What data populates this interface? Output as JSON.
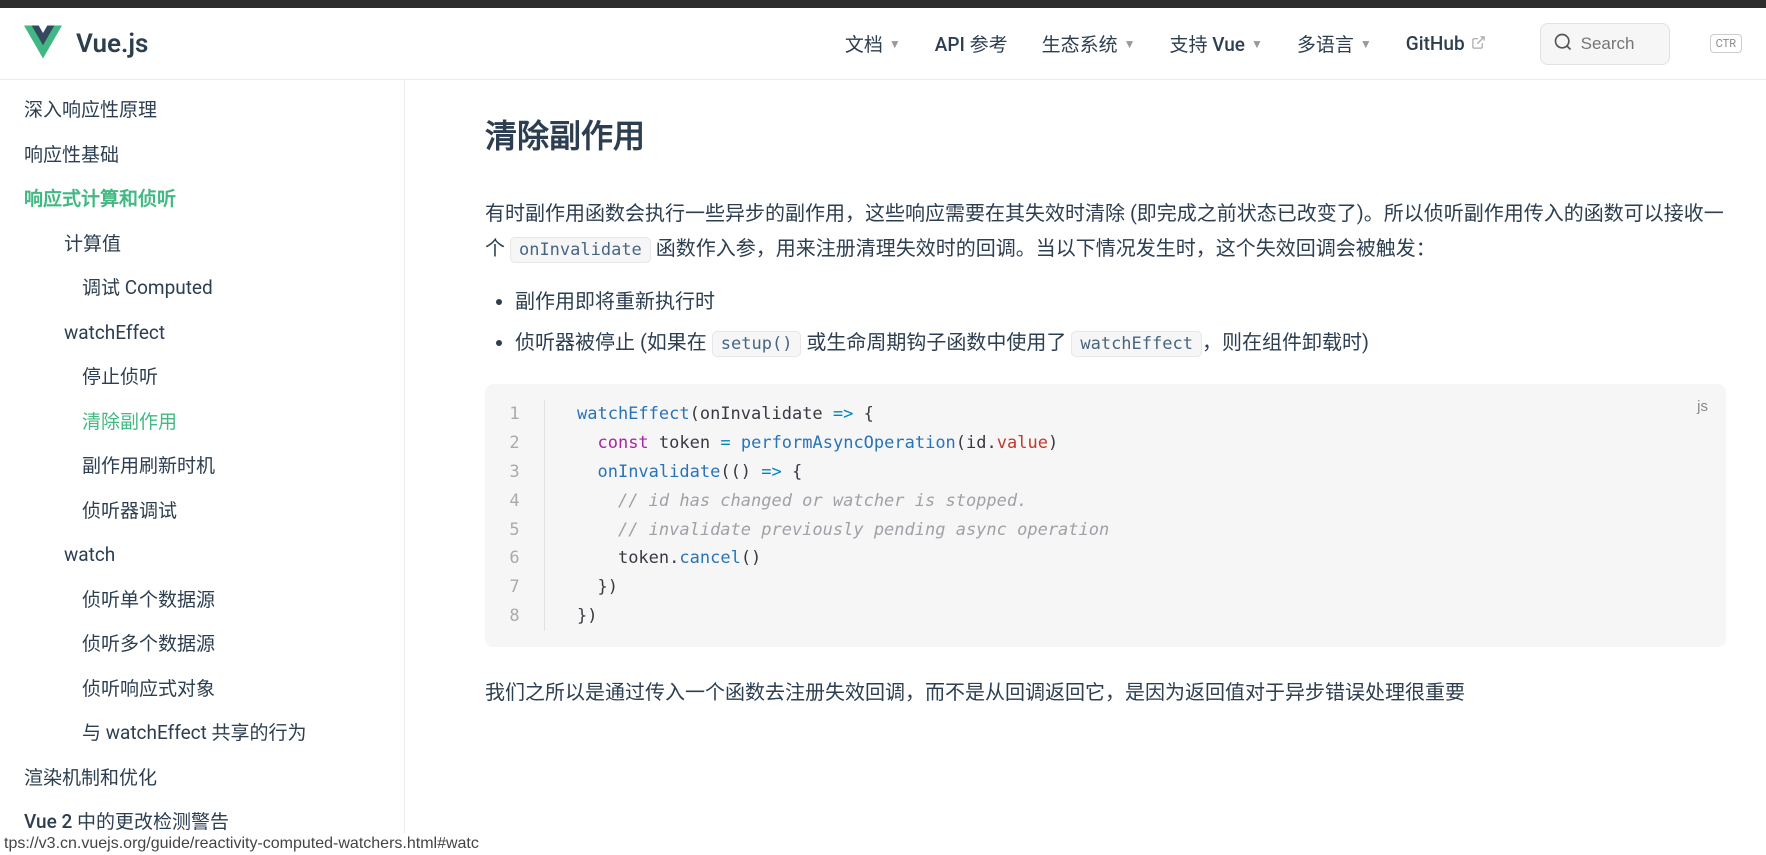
{
  "header": {
    "brand": "Vue.js",
    "nav": [
      {
        "label": "文档",
        "dropdown": true
      },
      {
        "label": "API 参考",
        "dropdown": false
      },
      {
        "label": "生态系统",
        "dropdown": true
      },
      {
        "label": "支持 Vue",
        "dropdown": true
      },
      {
        "label": "多语言",
        "dropdown": true
      },
      {
        "label": "GitHub",
        "external": true
      }
    ],
    "search_placeholder": "Search",
    "kbd_hint": "CTR"
  },
  "sidebar": [
    {
      "label": "深入响应性原理",
      "level": 1
    },
    {
      "label": "响应性基础",
      "level": 1
    },
    {
      "label": "响应式计算和侦听",
      "level": 1,
      "selected": true
    },
    {
      "label": "计算值",
      "level": 2
    },
    {
      "label": "调试 Computed",
      "level": 3
    },
    {
      "label": "watchEffect",
      "level": 2
    },
    {
      "label": "停止侦听",
      "level": 3
    },
    {
      "label": "清除副作用",
      "level": 3,
      "active": true
    },
    {
      "label": "副作用刷新时机",
      "level": 3
    },
    {
      "label": "侦听器调试",
      "level": 3
    },
    {
      "label": "watch",
      "level": 2
    },
    {
      "label": "侦听单个数据源",
      "level": 3
    },
    {
      "label": "侦听多个数据源",
      "level": 3
    },
    {
      "label": "侦听响应式对象",
      "level": 3
    },
    {
      "label": "与 watchEffect 共享的行为",
      "level": 3
    },
    {
      "label": "渲染机制和优化",
      "level": 1,
      "pl": 24
    },
    {
      "label": "Vue 2 中的更改检测警告",
      "level": 1,
      "pl": 24
    }
  ],
  "content": {
    "heading": "清除副作用",
    "p1_a": "有时副作用函数会执行一些异步的副作用，这些响应需要在其失效时清除 (即完成之前状态已改变了)。所以侦听副作用传入的函数可以接收一个 ",
    "p1_code": "onInvalidate",
    "p1_b": " 函数作入参，用来注册清理失效时的回调。当以下情况发生时，这个失效回调会被触发：",
    "li1": "副作用即将重新执行时",
    "li2_a": "侦听器被停止 (如果在 ",
    "li2_c1": "setup()",
    "li2_b": " 或生命周期钩子函数中使用了 ",
    "li2_c2": "watchEffect",
    "li2_c": "，则在组件卸载时)",
    "p2": "我们之所以是通过传入一个函数去注册失效回调，而不是从回调返回它，是因为返回值对于异步错误处理很重要",
    "code_lang": "js",
    "code_lines": [
      {
        "n": "1",
        "html": "<span class='tok-fn'>watchEffect</span><span class='tok-p'>(</span><span class='tok-var'>onInvalidate</span> <span class='tok-op'>=&gt;</span> <span class='tok-p'>{</span>"
      },
      {
        "n": "2",
        "html": "  <span class='tok-kw'>const</span> <span class='tok-var'>token</span> <span class='tok-op'>=</span> <span class='tok-fn'>performAsyncOperation</span><span class='tok-p'>(</span><span class='tok-var'>id</span><span class='tok-p'>.</span><span class='tok-prop'>value</span><span class='tok-p'>)</span>"
      },
      {
        "n": "3",
        "html": "  <span class='tok-fn'>onInvalidate</span><span class='tok-p'>(</span><span class='tok-p'>()</span> <span class='tok-op'>=&gt;</span> <span class='tok-p'>{</span>"
      },
      {
        "n": "4",
        "html": "    <span class='tok-cmnt'>// id has changed or watcher is stopped.</span>"
      },
      {
        "n": "5",
        "html": "    <span class='tok-cmnt'>// invalidate previously pending async operation</span>"
      },
      {
        "n": "6",
        "html": "    <span class='tok-var'>token</span><span class='tok-p'>.</span><span class='tok-fn'>cancel</span><span class='tok-p'>()</span>"
      },
      {
        "n": "7",
        "html": "  <span class='tok-p'>})</span>"
      },
      {
        "n": "8",
        "html": "<span class='tok-p'>})</span>"
      }
    ]
  },
  "status_url": "tps://v3.cn.vuejs.org/guide/reactivity-computed-watchers.html#watc"
}
